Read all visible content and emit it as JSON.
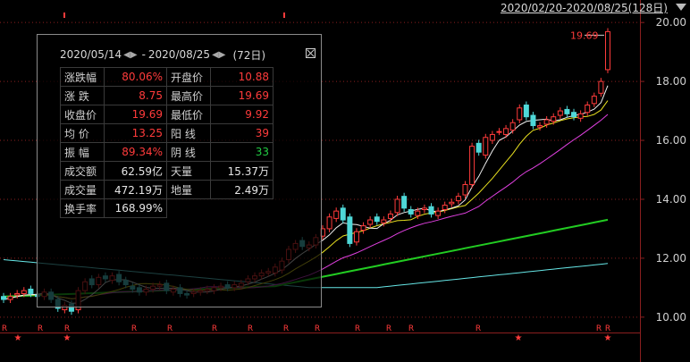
{
  "header": {
    "range_label": "2020/02/20-2020/08/25(128日)"
  },
  "stats_panel": {
    "date_start": "2020/05/14",
    "date_end": "2020/08/25",
    "separator": "-",
    "days": "(72日)",
    "rows": [
      {
        "l1": "涨跌幅",
        "v1": "80.06%",
        "c1": "up",
        "l2": "开盘价",
        "v2": "10.88",
        "c2": "up"
      },
      {
        "l1": "涨 跌",
        "v1": "8.75",
        "c1": "up",
        "l2": "最高价",
        "v2": "19.69",
        "c2": "up"
      },
      {
        "l1": "收盘价",
        "v1": "19.69",
        "c1": "up",
        "l2": "最低价",
        "v2": "9.92",
        "c2": "up"
      },
      {
        "l1": "均 价",
        "v1": "13.25",
        "c1": "up",
        "l2": "阳 线",
        "v2": "39",
        "c2": "up"
      },
      {
        "l1": "振 幅",
        "v1": "89.34%",
        "c1": "up",
        "l2": "阴 线",
        "v2": "33",
        "c2": "down"
      },
      {
        "l1": "成交额",
        "v1": "62.59亿",
        "c1": "neutral",
        "l2": "天量",
        "v2": "15.37万",
        "c2": "neutral"
      },
      {
        "l1": "成交量",
        "v1": "472.19万",
        "c1": "neutral",
        "l2": "地量",
        "v2": "2.49万",
        "c2": "neutral"
      },
      {
        "l1": "换手率",
        "v1": "168.99%",
        "c1": "neutral"
      }
    ]
  },
  "colors": {
    "up": "#ff3b3b",
    "down": "#22cc44",
    "candle_down": "#4fd8d8",
    "ma5": "#f0f0f0",
    "ma10": "#e8e020",
    "ma20": "#e040e0",
    "ma60": "#22cc22",
    "ma120": "#66e6e6",
    "grid": "#8b1f1f"
  },
  "chart_data": {
    "type": "candlestick",
    "ylim": [
      9.6,
      20.4
    ],
    "yticks": [
      10.0,
      12.0,
      14.0,
      16.0,
      18.0,
      20.0
    ],
    "ytick_labels": [
      "10.00",
      "12.00",
      "14.00",
      "16.00",
      "18.00",
      "20.00"
    ],
    "high_label": "19.69",
    "closes": [
      10.6,
      10.7,
      10.8,
      10.9,
      10.8,
      10.7,
      10.85,
      10.6,
      10.3,
      10.4,
      10.2,
      10.9,
      11.2,
      11.1,
      11.35,
      11.3,
      11.4,
      11.2,
      11.1,
      10.95,
      10.85,
      10.95,
      11.05,
      11.1,
      10.9,
      10.95,
      10.8,
      10.75,
      10.85,
      10.9,
      10.95,
      11.0,
      11.05,
      11.0,
      11.1,
      11.15,
      11.3,
      11.4,
      11.5,
      11.55,
      11.7,
      11.9,
      12.3,
      12.5,
      12.4,
      12.45,
      12.7,
      13.0,
      13.4,
      13.6,
      13.3,
      12.5,
      12.9,
      13.1,
      13.3,
      13.25,
      13.3,
      13.5,
      14.0,
      13.7,
      13.5,
      13.6,
      13.7,
      13.5,
      13.6,
      13.8,
      13.9,
      14.1,
      14.5,
      15.8,
      15.6,
      16.1,
      16.2,
      16.3,
      16.4,
      16.6,
      17.1,
      16.8,
      16.5,
      16.5,
      16.7,
      16.8,
      17.0,
      16.9,
      16.8,
      16.9,
      17.2,
      17.5,
      18.0,
      19.69
    ],
    "opens": [
      10.7,
      10.6,
      10.75,
      10.8,
      10.95,
      10.75,
      10.7,
      10.85,
      10.6,
      10.25,
      10.45,
      10.25,
      10.9,
      11.3,
      11.1,
      11.4,
      11.25,
      11.45,
      11.25,
      11.05,
      11.0,
      10.85,
      10.95,
      11.05,
      11.15,
      10.85,
      11.0,
      10.8,
      10.8,
      10.85,
      10.9,
      10.9,
      11.0,
      11.1,
      11.0,
      11.05,
      11.2,
      11.3,
      11.4,
      11.5,
      11.5,
      11.6,
      11.95,
      12.3,
      12.6,
      12.35,
      12.45,
      12.75,
      13.0,
      13.35,
      13.7,
      13.4,
      12.55,
      12.95,
      13.15,
      13.4,
      13.2,
      13.35,
      13.55,
      14.1,
      13.65,
      13.45,
      13.65,
      13.75,
      13.45,
      13.65,
      13.85,
      13.95,
      14.15,
      14.5,
      15.9,
      15.5,
      16.0,
      16.3,
      16.2,
      16.35,
      16.7,
      17.2,
      16.85,
      16.45,
      16.55,
      16.65,
      16.85,
      17.05,
      16.95,
      16.75,
      16.95,
      17.25,
      17.6,
      18.4
    ],
    "r_markers_top": [
      5,
      45,
      75,
      150,
      190,
      240,
      280,
      320,
      355,
      400,
      435,
      460,
      535,
      670,
      680
    ],
    "star_markers": [
      20,
      75,
      580,
      680
    ]
  }
}
